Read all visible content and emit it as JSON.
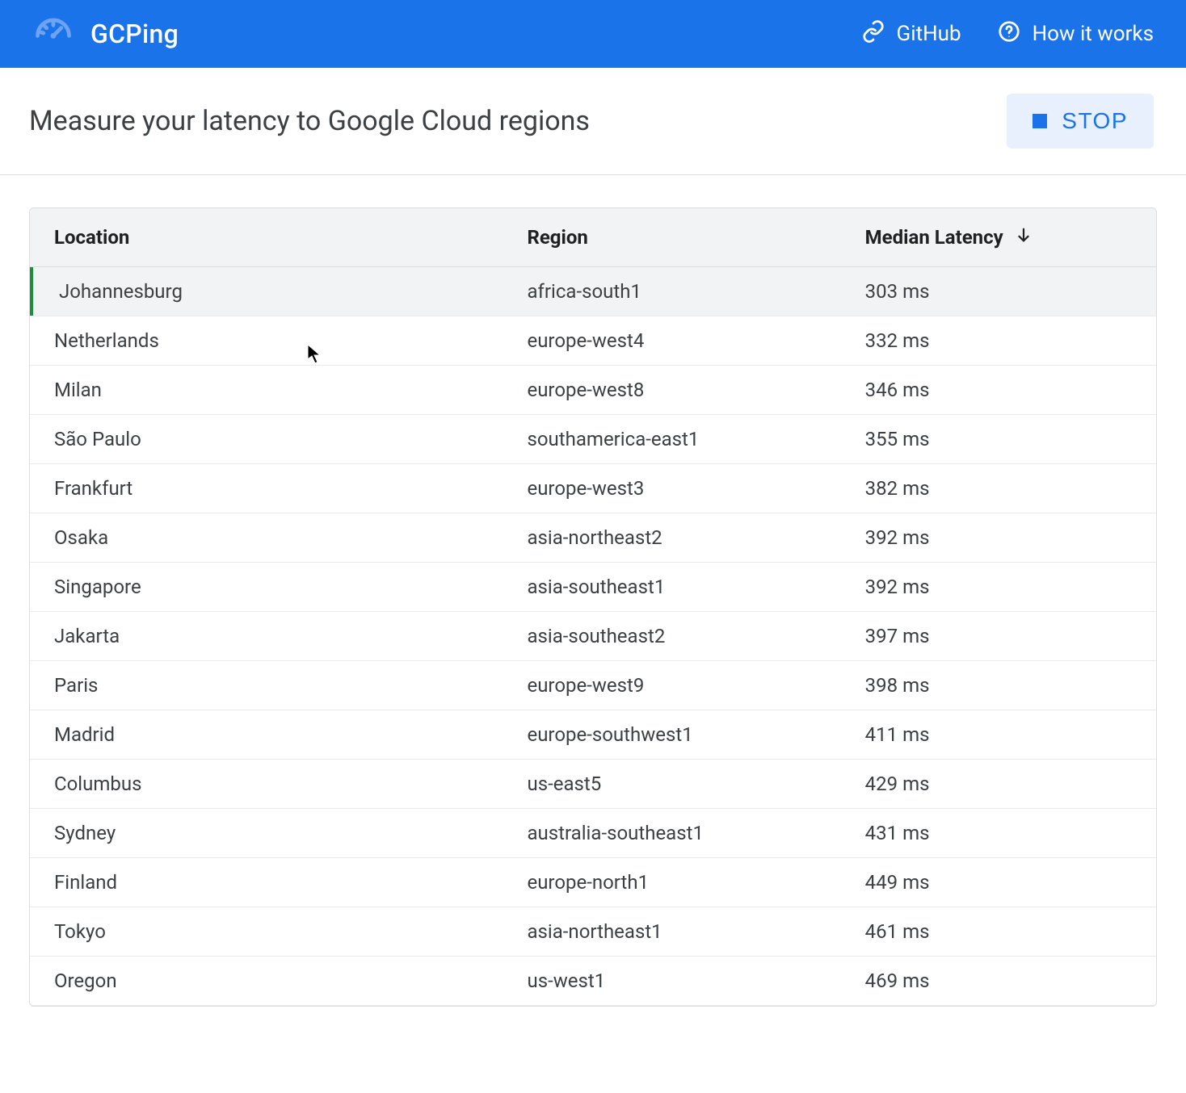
{
  "header": {
    "title": "GCPing",
    "links": [
      {
        "label": "GitHub"
      },
      {
        "label": "How it works"
      }
    ]
  },
  "subheader": {
    "title": "Measure your latency to Google Cloud regions",
    "stop_label": "STOP"
  },
  "table": {
    "columns": {
      "location": "Location",
      "region": "Region",
      "latency": "Median Latency"
    },
    "rows": [
      {
        "location": "Johannesburg",
        "region": "africa-south1",
        "latency": "303 ms",
        "highlight": true
      },
      {
        "location": "Netherlands",
        "region": "europe-west4",
        "latency": "332 ms"
      },
      {
        "location": "Milan",
        "region": "europe-west8",
        "latency": "346 ms"
      },
      {
        "location": "São Paulo",
        "region": "southamerica-east1",
        "latency": "355 ms"
      },
      {
        "location": "Frankfurt",
        "region": "europe-west3",
        "latency": "382 ms"
      },
      {
        "location": "Osaka",
        "region": "asia-northeast2",
        "latency": "392 ms"
      },
      {
        "location": "Singapore",
        "region": "asia-southeast1",
        "latency": "392 ms"
      },
      {
        "location": "Jakarta",
        "region": "asia-southeast2",
        "latency": "397 ms"
      },
      {
        "location": "Paris",
        "region": "europe-west9",
        "latency": "398 ms"
      },
      {
        "location": "Madrid",
        "region": "europe-southwest1",
        "latency": "411 ms"
      },
      {
        "location": "Columbus",
        "region": "us-east5",
        "latency": "429 ms"
      },
      {
        "location": "Sydney",
        "region": "australia-southeast1",
        "latency": "431 ms"
      },
      {
        "location": "Finland",
        "region": "europe-north1",
        "latency": "449 ms"
      },
      {
        "location": "Tokyo",
        "region": "asia-northeast1",
        "latency": "461 ms"
      },
      {
        "location": "Oregon",
        "region": "us-west1",
        "latency": "469 ms"
      }
    ]
  }
}
